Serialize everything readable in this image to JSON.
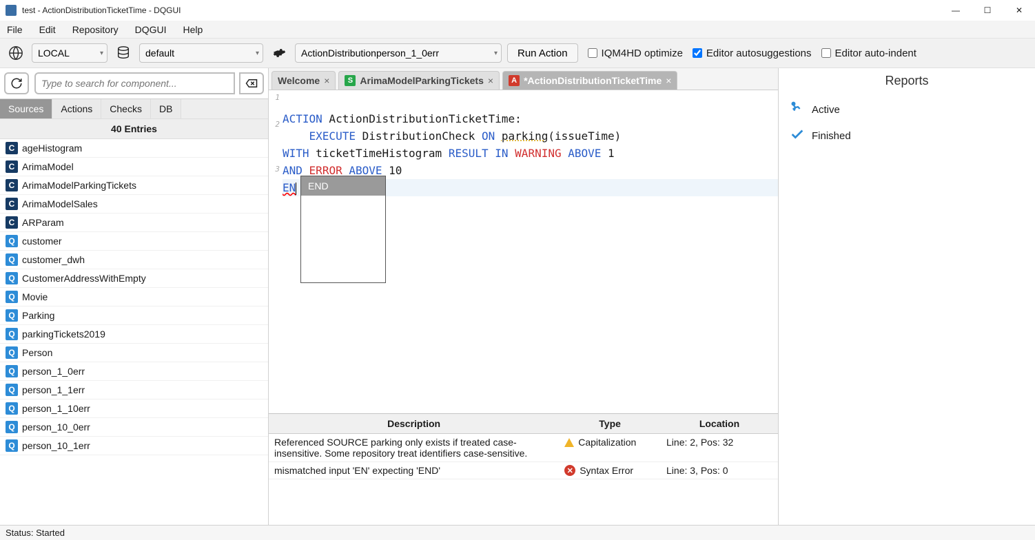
{
  "window": {
    "title": "test - ActionDistributionTicketTime - DQGUI"
  },
  "menu": [
    "File",
    "Edit",
    "Repository",
    "DQGUI",
    "Help"
  ],
  "toolbar": {
    "envSelect": "LOCAL",
    "dbSelect": "default",
    "actionSelect": "ActionDistributionperson_1_0err",
    "runLabel": "Run Action",
    "chk1": "IQM4HD optimize",
    "chk2": "Editor autosuggestions",
    "chk3": "Editor auto-indent",
    "chk2Checked": true
  },
  "left": {
    "searchPlaceholder": "Type to search for component...",
    "tabs": [
      "Sources",
      "Actions",
      "Checks",
      "DB"
    ],
    "activeTab": 0,
    "header": "40 Entries",
    "items": [
      {
        "t": "c",
        "label": "ageHistogram"
      },
      {
        "t": "c",
        "label": "ArimaModel"
      },
      {
        "t": "c",
        "label": "ArimaModelParkingTickets"
      },
      {
        "t": "c",
        "label": "ArimaModelSales"
      },
      {
        "t": "c",
        "label": "ARParam"
      },
      {
        "t": "q",
        "label": "customer"
      },
      {
        "t": "q",
        "label": "customer_dwh"
      },
      {
        "t": "q",
        "label": "CustomerAddressWithEmpty"
      },
      {
        "t": "q",
        "label": "Movie"
      },
      {
        "t": "q",
        "label": "Parking"
      },
      {
        "t": "q",
        "label": "parkingTickets2019"
      },
      {
        "t": "q",
        "label": "Person"
      },
      {
        "t": "q",
        "label": "person_1_0err"
      },
      {
        "t": "q",
        "label": "person_1_1err"
      },
      {
        "t": "q",
        "label": "person_1_10err"
      },
      {
        "t": "q",
        "label": "person_10_0err"
      },
      {
        "t": "q",
        "label": "person_10_1err"
      }
    ]
  },
  "editorTabs": [
    {
      "label": "Welcome",
      "type": "",
      "active": false
    },
    {
      "label": "ArimaModelParkingTickets",
      "type": "s",
      "active": false
    },
    {
      "label": "*ActionDistributionTicketTime",
      "type": "a",
      "active": true
    }
  ],
  "code": {
    "line1_action": "ACTION",
    "line1_rest": " ActionDistributionTicketTime:",
    "line2_indent": "    ",
    "line2_exec": "EXECUTE",
    "line2_mid": " DistributionCheck ",
    "line2_on": "ON",
    "line2_sp": " ",
    "line2_parking": "parking",
    "line2_args": "(issueTime) ",
    "line2_with": "WITH",
    "line2_hist": " ticketTimeHistogram ",
    "line2_result": "RESULT IN",
    "line2_sp2": " ",
    "line2_warn": "WARNING",
    "line2_sp3": " ",
    "line2_above": "ABOVE",
    "line2_num1": " 1 ",
    "line2_and": "AND",
    "line2_sp4": " ",
    "line2_err": "ERROR",
    "line2_sp5": " ",
    "line2_above2": "ABOVE",
    "line2_num2": " 10",
    "line3": "EN",
    "gutter": [
      "1",
      "2",
      "3"
    ],
    "autocomplete": "END"
  },
  "problems": {
    "headers": [
      "Description",
      "Type",
      "Location"
    ],
    "rows": [
      {
        "desc": "Referenced SOURCE parking only exists if treated case-insensitive. Some repository treat identifiers case-sensitive.",
        "type": "Capitalization",
        "loc": "Line: 2, Pos: 32",
        "icon": "warn"
      },
      {
        "desc": "mismatched input 'EN' expecting 'END'",
        "type": "Syntax Error",
        "loc": "Line: 3, Pos: 0",
        "icon": "err"
      }
    ]
  },
  "reports": {
    "title": "Reports",
    "items": [
      {
        "label": "Active",
        "icon": "run"
      },
      {
        "label": "Finished",
        "icon": "check"
      }
    ]
  },
  "status": "Status: Started"
}
